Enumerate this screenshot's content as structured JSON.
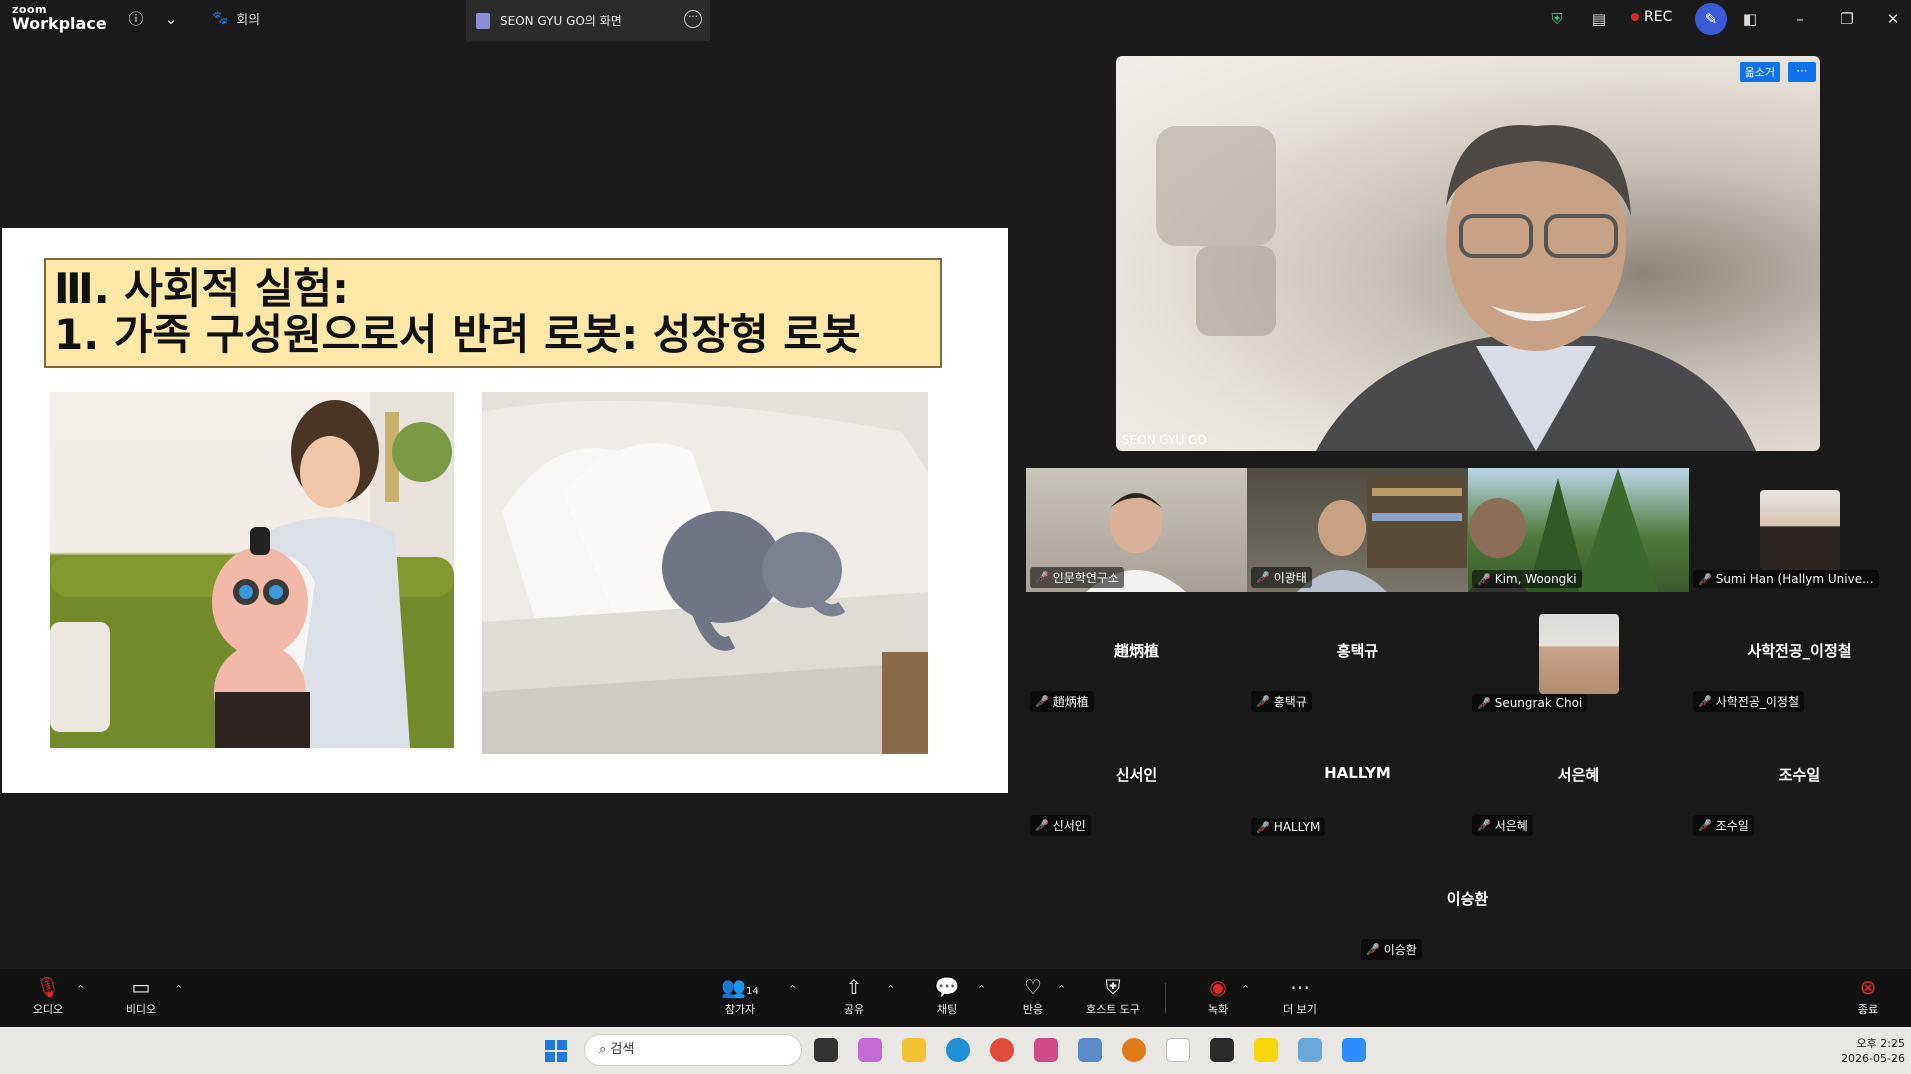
{
  "app": {
    "logo_top": "zoom",
    "logo_bottom": "Workplace"
  },
  "tabs": {
    "meeting": "회의",
    "share": "SEON GYU GO의 화면"
  },
  "status": {
    "rec": "REC"
  },
  "slide": {
    "title_line1": "Ⅲ. 사회적 실험:",
    "title_line2": "1. 가족 구성원으로서 반려 로봇: 성장형 로봇"
  },
  "speaker": {
    "name": "SEON GYU GO",
    "badge": "옮소거",
    "more": "···"
  },
  "participants": [
    {
      "name": "인문학연구소",
      "type": "video"
    },
    {
      "name": "이광태",
      "type": "video"
    },
    {
      "name": "Kim, Woongki",
      "type": "video"
    },
    {
      "name": "Sumi Han (Hallym Unive...",
      "type": "photo"
    },
    {
      "name": "趙炳植",
      "display": "趙炳植",
      "type": "name"
    },
    {
      "name": "홍택규",
      "display": "홍택규",
      "type": "name"
    },
    {
      "name": "Seungrak Choi",
      "type": "photo"
    },
    {
      "name": "사학전공_이정철",
      "display": "사학전공_이정철",
      "type": "name"
    },
    {
      "name": "신서인",
      "display": "신서인",
      "type": "name"
    },
    {
      "name": "HALLYM",
      "display": "HALLYM",
      "type": "name"
    },
    {
      "name": "서은혜",
      "display": "서은혜",
      "type": "name"
    },
    {
      "name": "조수일",
      "display": "조수일",
      "type": "name"
    },
    {
      "name": "이승환",
      "display": "이승환",
      "type": "name"
    }
  ],
  "toolbar": {
    "audio": "오디오",
    "video": "비디오",
    "participants": "참가자",
    "participants_count": "14",
    "share": "공유",
    "chat": "채팅",
    "react": "반응",
    "host_tools": "호스트 도구",
    "record": "녹화",
    "more": "더 보기",
    "end": "종료"
  },
  "taskbar": {
    "search_placeholder": "검색",
    "time": "오후 2:25",
    "date": "2026-05-26"
  }
}
